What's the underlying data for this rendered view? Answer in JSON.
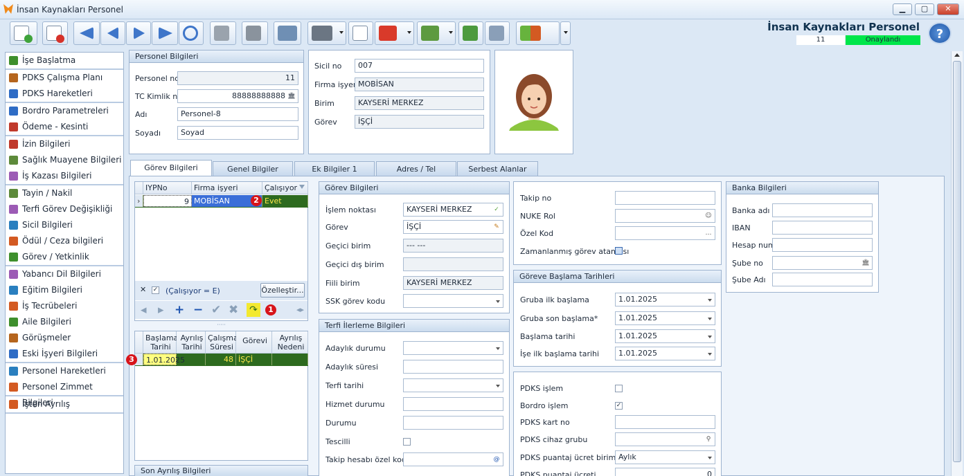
{
  "window": {
    "title": "İnsan Kaynakları Personel"
  },
  "header": {
    "title": "İnsan Kaynakları Personel",
    "count": "11",
    "status": "Onaylandı",
    "status_color": "#00e64a",
    "help": "?"
  },
  "menu": [
    [
      "İşe Başlatma"
    ],
    [
      "PDKS Çalışma Planı",
      "PDKS Hareketleri"
    ],
    [
      "Bordro Parametreleri",
      "Ödeme - Kesinti"
    ],
    [
      "İzin Bilgileri",
      "Sağlık Muayene Bilgileri",
      "İş Kazası Bilgileri"
    ],
    [
      "Tayin / Nakil",
      "Terfi Görev Değişikliği",
      "Sicil Bilgileri",
      "Ödül / Ceza bilgileri",
      "Görev / Yetkinlik"
    ],
    [
      "Yabancı Dil Bilgileri",
      "Eğitim Bilgileri",
      "İş Tecrübeleri",
      "Aile Bilgileri",
      "Görüşmeler",
      "Eski İşyeri Bilgileri"
    ],
    [
      "Personel Hareketleri",
      "Personel Zimmet Bilgileri"
    ],
    [
      "İşten Ayrılış"
    ]
  ],
  "personel": {
    "header": "Personel Bilgileri",
    "no_label": "Personel no",
    "no": "11",
    "tc_label": "TC Kimlik no",
    "tc": "88888888888",
    "ad_label": "Adı",
    "ad": "Personel-8",
    "soyad_label": "Soyadı",
    "soyad": "Soyad"
  },
  "sicil": {
    "no_label": "Sicil no",
    "no": "007",
    "firma_label": "Firma işyeri",
    "firma": "MOBİSAN",
    "birim_label": "Birim",
    "birim": "KAYSERİ MERKEZ",
    "gorev_label": "Görev",
    "gorev": "İŞÇİ"
  },
  "tabs": [
    "Görev Bilgileri",
    "Genel Bilgiler",
    "Ek Bilgiler 1",
    "Adres / Tel",
    "Serbest Alanlar"
  ],
  "iyp_grid": {
    "headers": [
      "IYPNo",
      "Firma işyeri",
      "Çalışıyor"
    ],
    "row": {
      "no": "9",
      "firma": "MOBİSAN",
      "calisiyor": "Evet"
    },
    "filter_text": "(Çalışıyor = E)",
    "customize": "Özelleştir..."
  },
  "gorev_grid": {
    "headers": [
      "Başlama Tarihi",
      "Ayrılış Tarihi",
      "Çalışma Süresi",
      "Görevi",
      "Ayrılış Nedeni"
    ],
    "row": {
      "baslama": "1.01.2025",
      "ayrilis": "",
      "sure": "48",
      "gorevi": "İŞÇİ",
      "neden": ""
    }
  },
  "son_ayrilis": "Son Ayrılış Bilgileri",
  "badges": [
    "1",
    "2",
    "3"
  ],
  "gorev_bilgileri": {
    "header": "Görev Bilgileri",
    "fields": [
      {
        "label": "İşlem noktası",
        "value": "KAYSERİ MERKEZ"
      },
      {
        "label": "Görev",
        "value": "İŞÇİ"
      },
      {
        "label": "Geçici birim",
        "value": "--- ---"
      },
      {
        "label": "Geçici dış birim",
        "value": ""
      },
      {
        "label": "Fiili birim",
        "value": "KAYSERİ MERKEZ"
      },
      {
        "label": "SSK görev kodu",
        "value": ""
      }
    ]
  },
  "terfi": {
    "header": "Terfi İlerleme Bilgileri",
    "fields": [
      {
        "label": "Adaylık durumu",
        "value": ""
      },
      {
        "label": "Adaylık süresi",
        "value": ""
      },
      {
        "label": "Terfi tarihi",
        "value": ""
      },
      {
        "label": "Hizmet durumu",
        "value": ""
      },
      {
        "label": "Durumu",
        "value": ""
      },
      {
        "label": "Tescilli",
        "value": ""
      },
      {
        "label": "Takip hesabı özel kodu",
        "value": ""
      }
    ]
  },
  "takip": {
    "fields": [
      {
        "label": "Takip no",
        "value": ""
      },
      {
        "label": "NUKE Rol",
        "value": ""
      },
      {
        "label": "Özel Kod",
        "value": ""
      },
      {
        "label": "Zamanlanmış görev ataması",
        "value": ""
      }
    ]
  },
  "baslama": {
    "header": "Göreve Başlama Tarihleri",
    "fields": [
      {
        "label": "Gruba ilk başlama",
        "value": "1.01.2025"
      },
      {
        "label": "Gruba son başlama*",
        "value": "1.01.2025"
      },
      {
        "label": "Başlama tarihi",
        "value": "1.01.2025"
      },
      {
        "label": "İşe ilk başlama tarihi",
        "value": "1.01.2025"
      }
    ]
  },
  "pdks": {
    "fields": [
      {
        "label": "PDKS işlem",
        "value": ""
      },
      {
        "label": "Bordro işlem",
        "value": "✓"
      },
      {
        "label": "PDKS kart no",
        "value": ""
      },
      {
        "label": "PDKS cihaz grubu",
        "value": ""
      },
      {
        "label": "PDKS puantaj ücret birimi",
        "value": "Aylık"
      },
      {
        "label": "PDKS puantaj ücreti",
        "value": "0"
      }
    ]
  },
  "banka": {
    "header": "Banka Bilgileri",
    "fields": [
      {
        "label": "Banka adı",
        "value": ""
      },
      {
        "label": "IBAN",
        "value": ""
      },
      {
        "label": "Hesap num",
        "value": ""
      },
      {
        "label": "Şube no",
        "value": ""
      },
      {
        "label": "Şube Adı",
        "value": ""
      }
    ]
  }
}
